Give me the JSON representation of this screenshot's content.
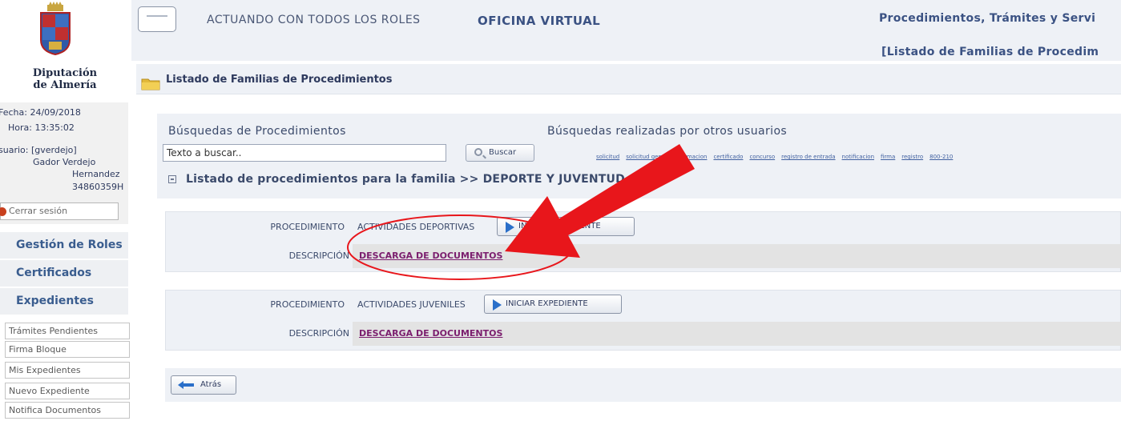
{
  "sidebar": {
    "org_line1": "Diputación",
    "org_line2": "de Almería",
    "date_line": "Fecha: 24/09/2018",
    "time_line": "Hora: 13:35:02",
    "user_line": "suario: [gverdejo]",
    "user_name1": "Gador Verdejo",
    "user_name2": "Hernandez",
    "user_id": "34860359H",
    "logout_label": "Cerrar sesión",
    "menu": [
      "Gestión de Roles",
      "Certificados",
      "Expedientes"
    ],
    "submenu": [
      "Trámites Pendientes",
      "Firma Bloque",
      "Mis Expedientes",
      "Nuevo Expediente",
      "Notifica Documentos"
    ]
  },
  "topbar": {
    "role_text": "ACTUANDO CON TODOS LOS ROLES",
    "office_text": "OFICINA VIRTUAL",
    "section_text": "Procedimientos, Trámites y Servi",
    "breadcrumb_text": "[Listado de Familias de Procedim"
  },
  "page": {
    "title": "Listado de Familias de Procedimientos"
  },
  "search": {
    "section_label": "Búsquedas de Procedimientos",
    "others_label": "Búsquedas realizadas por otros usuarios",
    "input_value": "Texto a buscar..",
    "button_label": "Buscar",
    "tags": [
      "solicitud",
      "solicitud general",
      "formacion",
      "certificado",
      "concurso",
      "registro de entrada",
      "notificacion",
      "firma",
      "registro",
      "800-210"
    ]
  },
  "family": {
    "text": "Listado de procedimientos para la familia  >> DEPORTE Y JUVENTUD"
  },
  "procedures": [
    {
      "proc_label": "PROCEDIMIENTO",
      "name": "ACTIVIDADES DEPORTIVAS",
      "button_label": "INICIAR EXPEDIENTE",
      "desc_label": "DESCRIPCIÓN",
      "link": "DESCARGA DE DOCUMENTOS"
    },
    {
      "proc_label": "PROCEDIMIENTO",
      "name": "ACTIVIDADES JUVENILES",
      "button_label": "INICIAR EXPEDIENTE",
      "desc_label": "DESCRIPCIÓN",
      "link": "DESCARGA DE DOCUMENTOS"
    }
  ],
  "footer": {
    "back_label": "Atrás"
  },
  "colors": {
    "accent": "#3b5283",
    "link": "#7b1e6e",
    "annotation": "#e8161b"
  }
}
